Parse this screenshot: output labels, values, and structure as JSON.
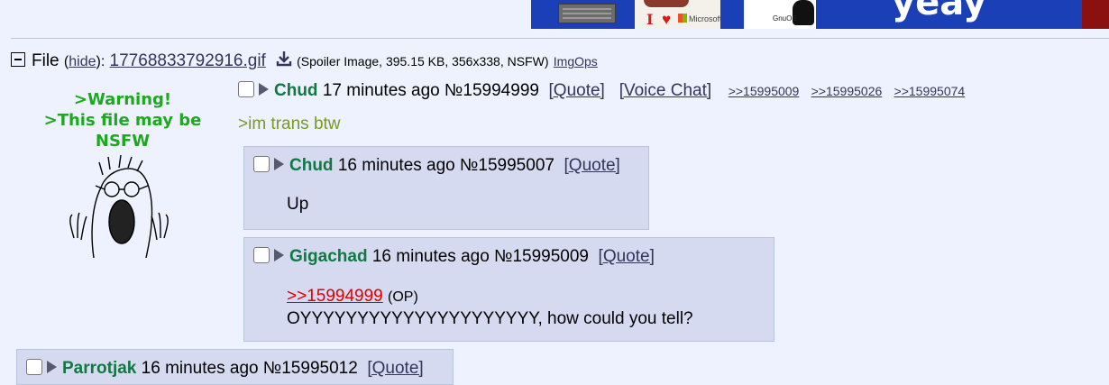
{
  "file": {
    "label": "File",
    "hide_open": "(",
    "hide_label": "hide",
    "hide_close": "):",
    "filename": "17768833792916.gif",
    "meta": "(Spoiler Image, 395.15 KB, 356x338, NSFW)",
    "imgops": "ImgOps"
  },
  "thumbnail": {
    "warning_text": ">Warning!\n>This file may be\nNSFW"
  },
  "op_post": {
    "name": "Chud",
    "time": "17 minutes ago",
    "number": "№15994999",
    "quote": "[Quote]",
    "voice_chat": "[Voice Chat]",
    "backlinks": [
      ">>15995009",
      ">>15995026",
      ">>15995074"
    ],
    "body": ">im trans btw"
  },
  "replies": [
    {
      "name": "Chud",
      "time": "16 minutes ago",
      "number": "№15995007",
      "quote": "[Quote]",
      "body": "Up"
    },
    {
      "name": "Gigachad",
      "time": "16 minutes ago",
      "number": "№15995009",
      "quote": "[Quote]",
      "quotelink": ">>15994999",
      "op_tag": "(OP)",
      "body": "OYYYYYYYYYYYYYYYYYYYYY, how could you tell?"
    },
    {
      "name": "Parrotjak",
      "time": "16 minutes ago",
      "number": "№15995012",
      "quote": "[Quote]"
    }
  ],
  "banner": {
    "i_text": "I",
    "heart": "♥",
    "ms_text": "Microsoft",
    "os_text": "GnuOS",
    "big_text": "yeay"
  },
  "colors": {
    "background": "#eef2ff",
    "reply_bg": "#d6daf0",
    "name": "#117743",
    "greentext": "#789922",
    "quotelink": "#dd0000",
    "link": "#34345c"
  }
}
